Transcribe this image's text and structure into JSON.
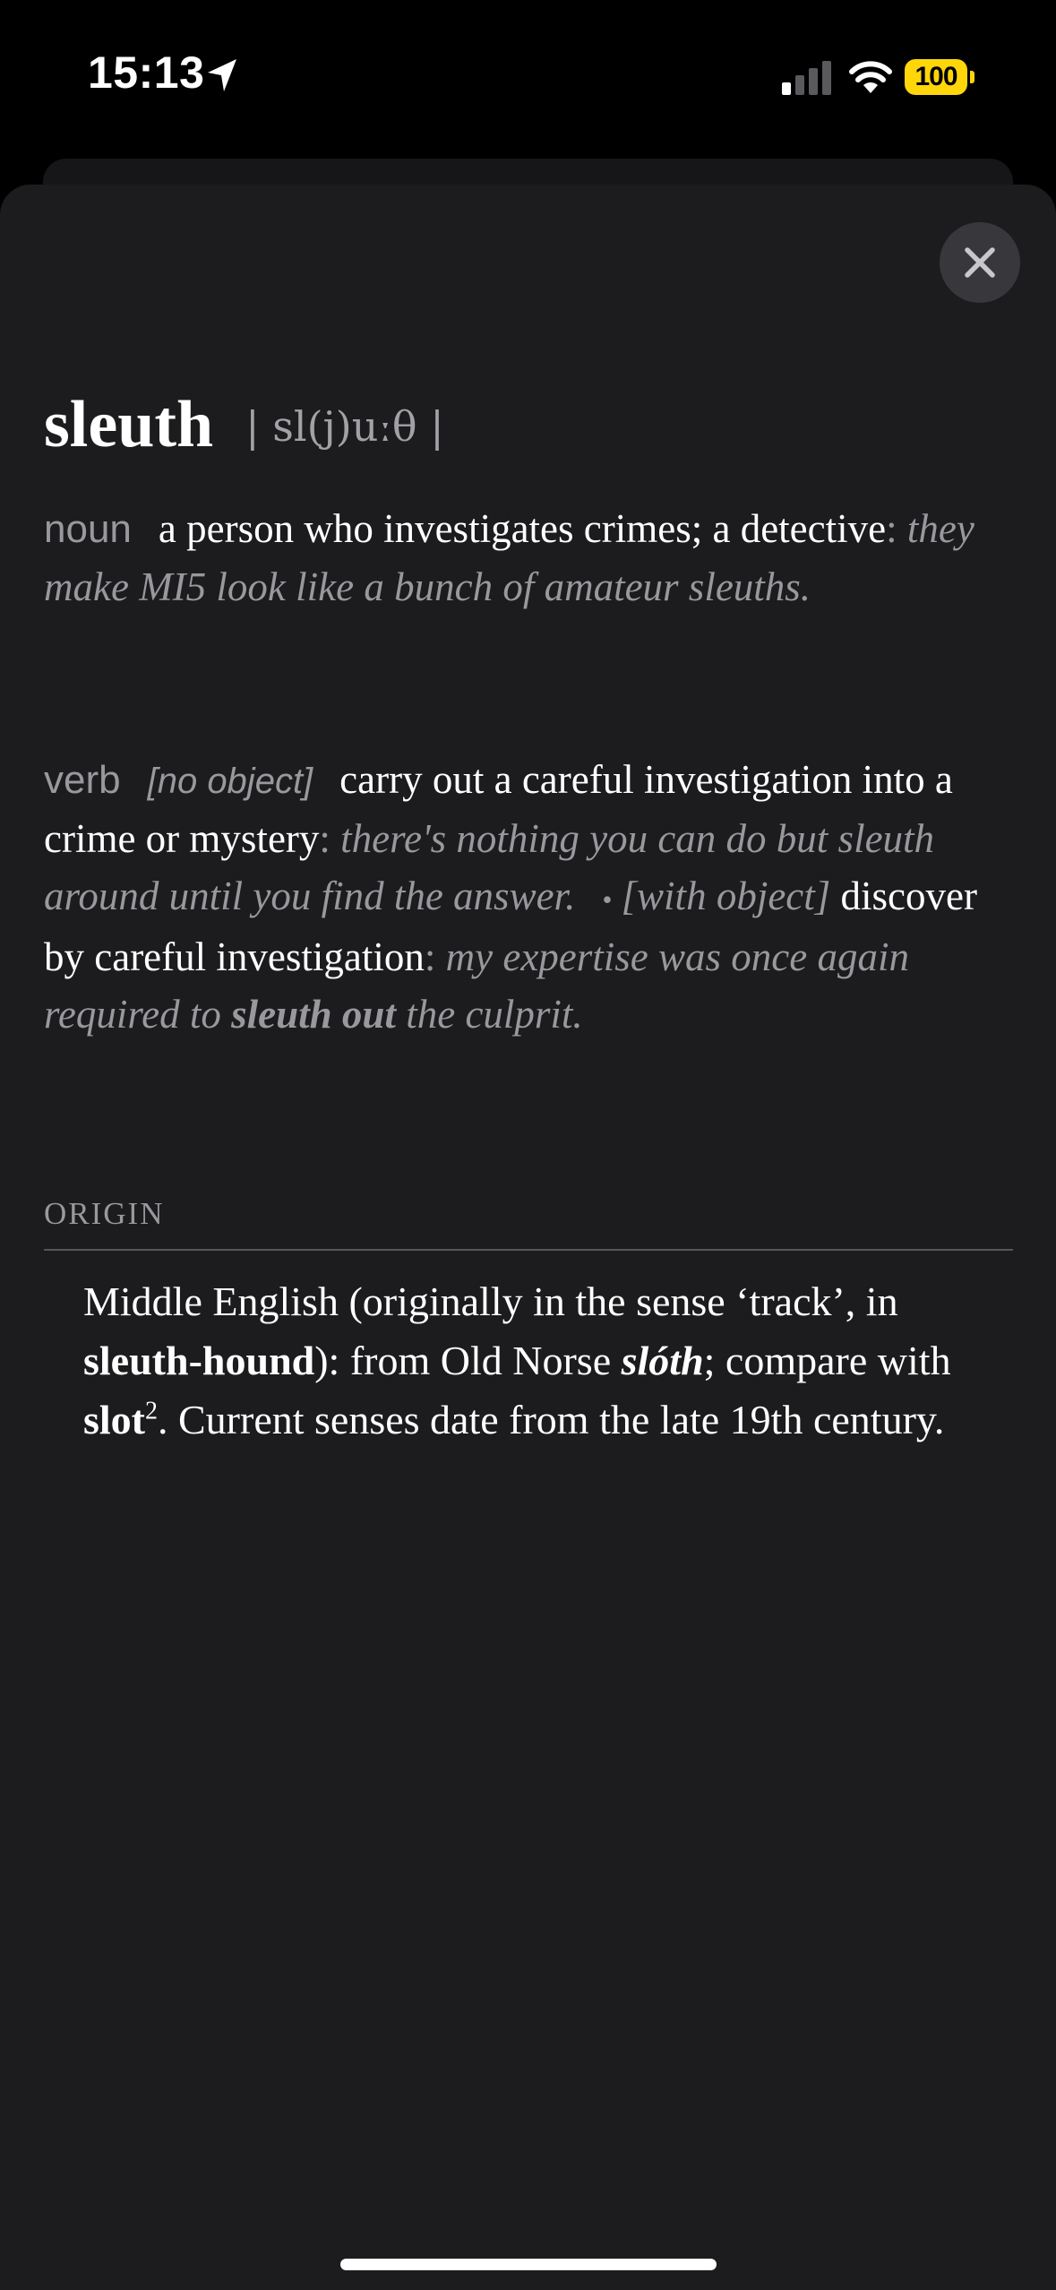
{
  "status_bar": {
    "time": "15:13",
    "battery": "100",
    "battery_color": "#ffd60a"
  },
  "colors": {
    "background": "#000000",
    "sheet": "#1c1c1e",
    "secondary_text": "#98989d",
    "close_button": "#38383c"
  },
  "icons": [
    "location-arrow-icon",
    "cellular-signal-icon",
    "wifi-icon",
    "battery-icon",
    "close-icon"
  ],
  "entry": {
    "headword": "sleuth",
    "pronunciation": "| sl(j)uːθ |",
    "noun": {
      "pos": "noun",
      "definition": "a person who investigates crimes; a detective",
      "separator": ": ",
      "example": "they make MI5 look like a bunch of amateur sleuths."
    },
    "verb": {
      "pos": "verb",
      "grammar": "[no object]",
      "definition": "carry out a careful investigation into a crime or mystery",
      "separator": ": ",
      "example": "there's nothing you can do but sleuth around until you find the answer.",
      "bullet": "•",
      "sub_grammar": "[with object]",
      "sub_definition": "discover by careful investigation",
      "sub_separator": ": ",
      "sub_example_before": "my expertise was once again required to ",
      "sub_example_bold": "sleuth out",
      "sub_example_after": " the culprit."
    },
    "origin": {
      "label": "ORIGIN",
      "t1": "Middle English (originally in the sense ‘track’, in ",
      "b1": "sleuth-hound",
      "t2": "): from Old Norse ",
      "bi1": "slóth",
      "t3": "; compare with ",
      "b2": "slot",
      "sup": "2",
      "t4": ". Current senses date from the late 19th century."
    }
  }
}
